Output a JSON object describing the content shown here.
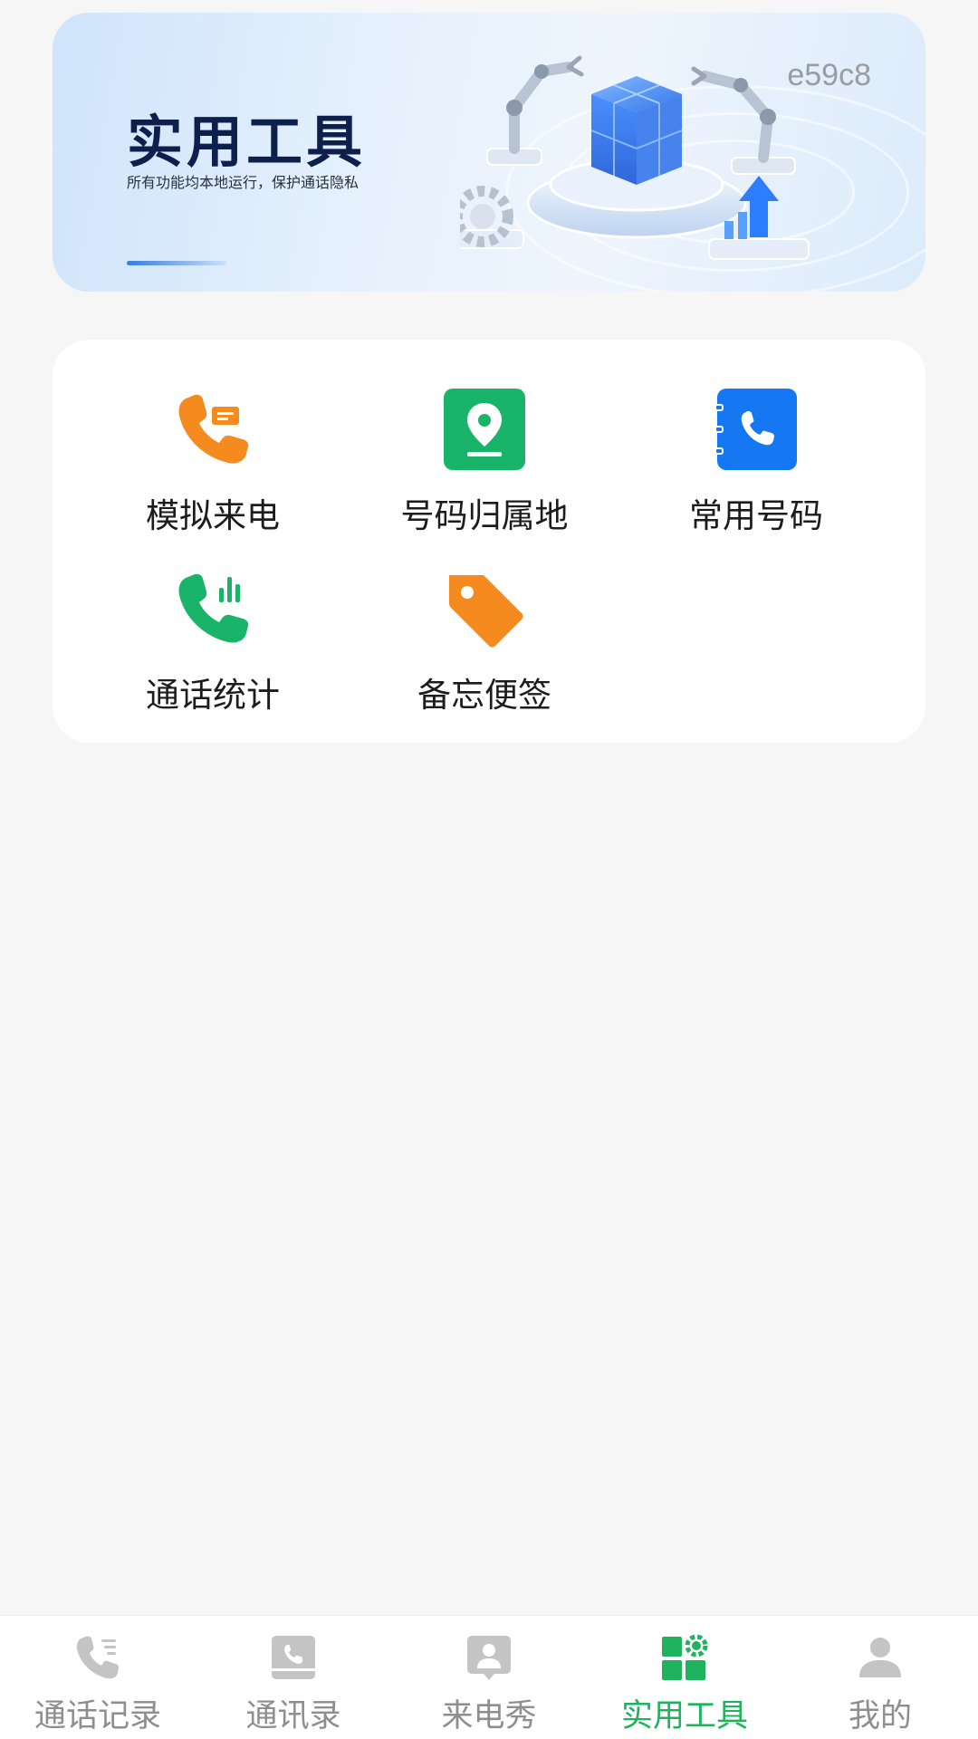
{
  "banner": {
    "title": "实用工具",
    "subtitle": "所有功能均本地运行，保护通话隐私",
    "watermark": "e59c8"
  },
  "tools": [
    {
      "label": "模拟来电",
      "icon": "phone-message-icon",
      "color": "#f58a1f"
    },
    {
      "label": "号码归属地",
      "icon": "location-pin-icon",
      "color": "#19b46a"
    },
    {
      "label": "常用号码",
      "icon": "phone-book-icon",
      "color": "#1677f2"
    },
    {
      "label": "通话统计",
      "icon": "phone-stats-icon",
      "color": "#19b46a"
    },
    {
      "label": "备忘便签",
      "icon": "tag-icon",
      "color": "#f58a1f"
    }
  ],
  "bottom_nav": {
    "items": [
      {
        "label": "通话记录",
        "icon": "call-log-icon",
        "active": false
      },
      {
        "label": "通讯录",
        "icon": "contacts-icon",
        "active": false
      },
      {
        "label": "来电秀",
        "icon": "caller-show-icon",
        "active": false
      },
      {
        "label": "实用工具",
        "icon": "tools-grid-icon",
        "active": true
      },
      {
        "label": "我的",
        "icon": "profile-icon",
        "active": false
      }
    ],
    "active_color": "#1fb35e",
    "inactive_color": "#8e8e8e"
  }
}
